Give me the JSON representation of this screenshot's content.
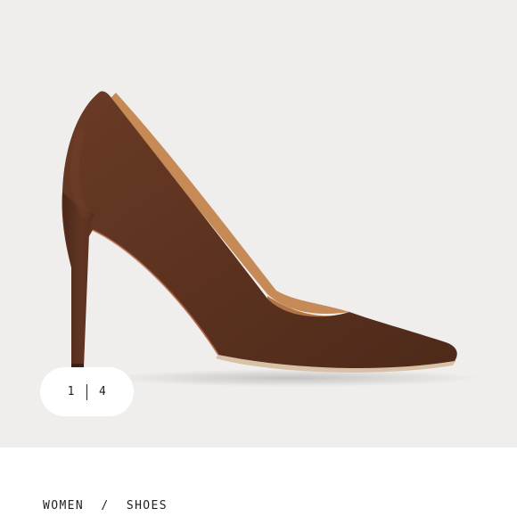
{
  "gallery": {
    "image_alt": "Brown suede pointed-toe stiletto pump",
    "current": "1",
    "total": "4"
  },
  "breadcrumb": {
    "items": [
      "WOMEN",
      "SHOES"
    ],
    "separator": "/"
  },
  "colors": {
    "gallery_bg": "#efeeed",
    "suede": "#5e3320",
    "lining": "#c58a55"
  }
}
